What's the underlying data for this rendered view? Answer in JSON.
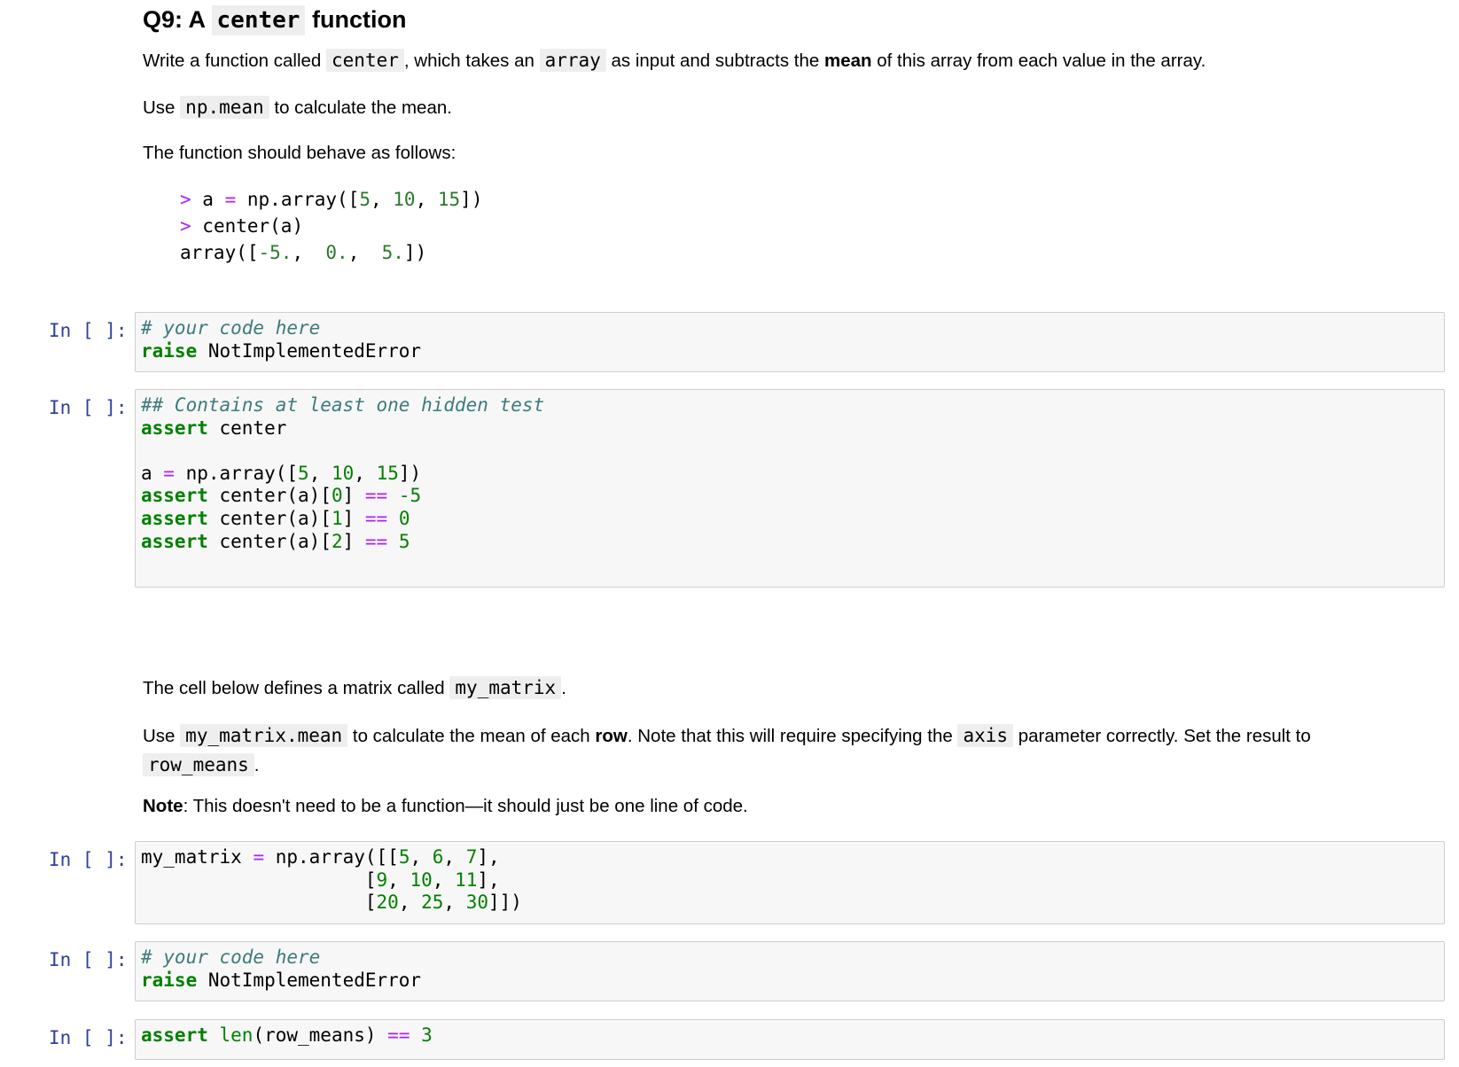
{
  "q9": {
    "title_prefix": "Q9: A",
    "title_code": "center",
    "title_suffix": "function",
    "p1_a": "Write a function called",
    "p1_code1": "center",
    "p1_b": ", which takes an",
    "p1_code2": "array",
    "p1_c": "as input and subtracts the",
    "p1_bold": "mean",
    "p1_d": "of this array from each value in the array.",
    "p2_a": "Use",
    "p2_code": "np.mean",
    "p2_b": "to calculate the mean.",
    "p3": "The function should behave as follows:",
    "example": {
      "l1_prompt": ">",
      "l1_text": " a ",
      "l1_eq": "=",
      "l1_rest": " np.array([",
      "l1_n1": "5",
      "l1_sep1": ", ",
      "l1_n2": "10",
      "l1_sep2": ", ",
      "l1_n3": "15",
      "l1_end": "])",
      "l2_prompt": ">",
      "l2_text": " center(a)",
      "l3_a": "array([",
      "l3_n1": "-5.",
      "l3_sep1": ",  ",
      "l3_n2": "0.",
      "l3_sep2": ",  ",
      "l3_n3": "5.",
      "l3_end": "])"
    }
  },
  "cells": {
    "prompt": "In [ ]:",
    "c1": {
      "comment": "# your code here",
      "kw": "raise",
      "rest": " NotImplementedError"
    },
    "c2": {
      "comment": "## Contains at least one hidden test",
      "kw": "assert",
      "l2_rest": " center",
      "l4_a": "a ",
      "l4_eq": "=",
      "l4_b": " np.array([",
      "l4_n1": "5",
      "l4_s1": ", ",
      "l4_n2": "10",
      "l4_s2": ", ",
      "l4_n3": "15",
      "l4_end": "])",
      "idx_open": " center(a)[",
      "idx_close": "] ",
      "eqeq": "==",
      "i0": "0",
      "v0": "-5",
      "i1": "1",
      "v1": "0",
      "i2": "2",
      "v2": "5"
    },
    "c3": {
      "l1_a": "my_matrix ",
      "l1_eq": "=",
      "l1_b": " np.array([[",
      "r1": [
        "5",
        "6",
        "7"
      ],
      "r2": [
        "9",
        "10",
        "11"
      ],
      "r3": [
        "20",
        "25",
        "30"
      ],
      "sep": ", ",
      "row_end": "],",
      "indent": "                    [",
      "last_end": "]])"
    },
    "c4": {
      "comment": "# your code here",
      "kw": "raise",
      "rest": " NotImplementedError"
    },
    "c5": {
      "kw": "assert",
      "builtin": "len",
      "rest": "(row_means) ",
      "eqeq": "==",
      "num": "3"
    }
  },
  "matrix_md": {
    "p1_a": "The cell below defines a matrix called",
    "p1_code": "my_matrix",
    "p1_b": ".",
    "p2_a": "Use",
    "p2_code1": "my_matrix.mean",
    "p2_b": "to calculate the mean of each",
    "p2_bold": "row",
    "p2_c": ". Note that this will require specifying the",
    "p2_code2": "axis",
    "p2_d": "parameter correctly. Set the result to",
    "p2_code3": "row_means",
    "p2_e": ".",
    "p3_bold": "Note",
    "p3_rest": ": This doesn't need to be a function—it should just be one line of code."
  }
}
